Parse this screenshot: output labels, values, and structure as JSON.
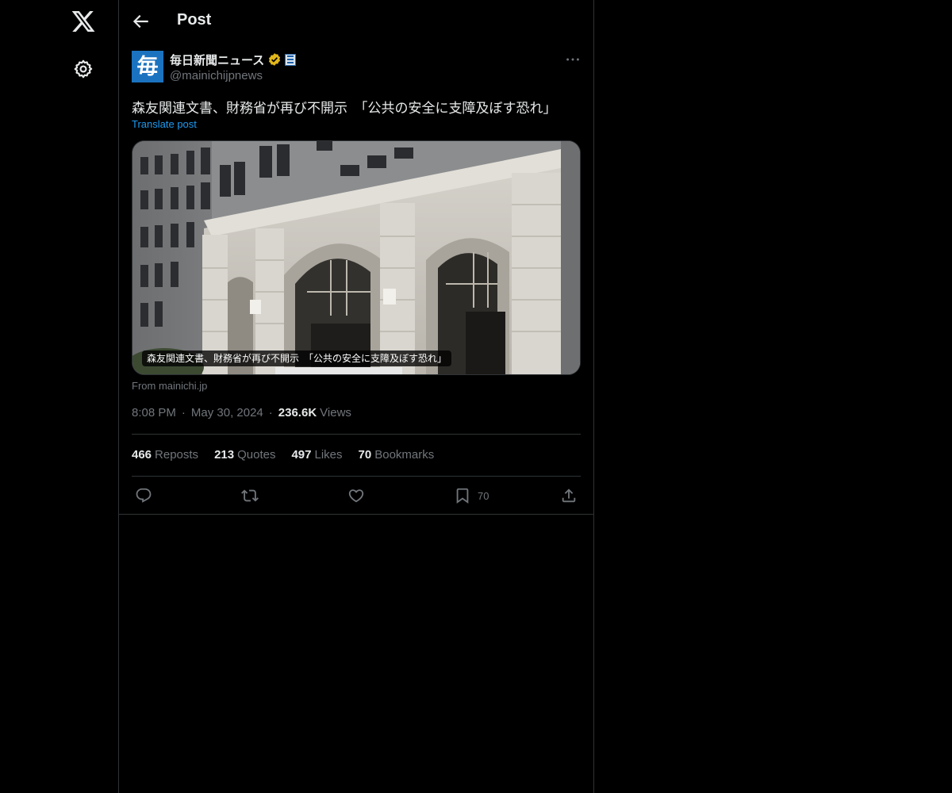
{
  "nav": {
    "logo_icon": "x-logo-icon",
    "settings_icon": "gear-icon"
  },
  "header": {
    "back_icon": "arrow-left-icon",
    "title": "Post"
  },
  "post": {
    "author": {
      "name": "毎日新聞ニュース",
      "handle": "@mainichijpnews",
      "avatar_glyph": "毎",
      "verified_icon": "verified-gold-badge-icon",
      "affiliation_icon": "newspaper-affiliate-icon"
    },
    "text": "森友関連文書、財務省が再び不開示　「公共の安全に支障及ぼす恐れ」",
    "translate_label": "Translate post",
    "card": {
      "image": "ministry-of-finance-building-photo",
      "caption": "森友関連文書、財務省が再び不開示　「公共の安全に支障及ぼす恐れ」",
      "source": "From mainichi.jp"
    },
    "meta": {
      "time": "8:08 PM",
      "date": "May 30, 2024",
      "views_count": "236.6K",
      "views_label": "Views"
    },
    "stats": [
      {
        "count": "466",
        "label": "Reposts"
      },
      {
        "count": "213",
        "label": "Quotes"
      },
      {
        "count": "497",
        "label": "Likes"
      },
      {
        "count": "70",
        "label": "Bookmarks"
      }
    ],
    "actions": {
      "reply_icon": "reply-icon",
      "repost_icon": "repost-icon",
      "like_icon": "heart-icon",
      "bookmark_icon": "bookmark-icon",
      "bookmark_count": "70",
      "share_icon": "share-icon"
    }
  },
  "colors": {
    "background": "#000000",
    "text": "#e7e9ea",
    "muted": "#71767b",
    "link": "#1d9bf0",
    "border": "#2f3336",
    "verified": "#e2b719",
    "avatar": "#1b73c0"
  }
}
